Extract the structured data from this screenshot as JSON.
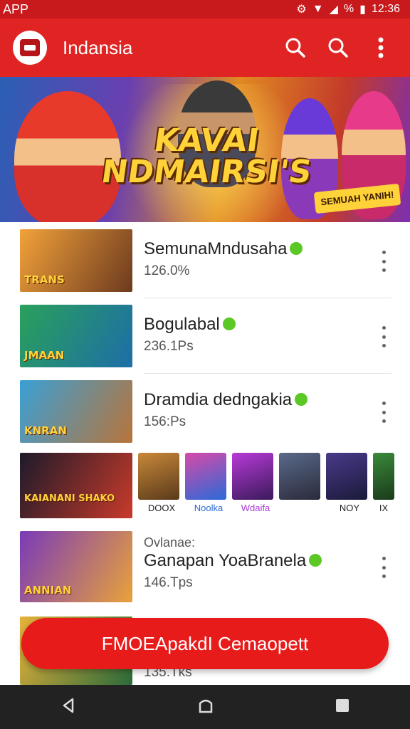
{
  "status_bar": {
    "left_label": "APP",
    "right_label": "%",
    "time": "12:36"
  },
  "app_bar": {
    "title": "Indansia"
  },
  "banner": {
    "title_line1": "KAVAI",
    "title_line2": "NDMAIRSI'S",
    "badge": "SEMUAH YANIH!"
  },
  "list": {
    "items": [
      {
        "title": "SemunaMndusaha",
        "sub": "126.0%",
        "thumb_label": "TRANS",
        "colors": [
          "#f2a23a",
          "#6d3a1f"
        ]
      },
      {
        "title": "Bogulabal",
        "sub": "236.1Ps",
        "thumb_label": "JMAAN",
        "colors": [
          "#2aa05a",
          "#1d6ea8"
        ]
      },
      {
        "title": "Dramdia dedngakia",
        "sub": "156:Ps",
        "thumb_label": "KNRAN",
        "colors": [
          "#3aa0d6",
          "#b8743a"
        ]
      },
      {
        "title": "Ganapan YoaBranela",
        "sub": "146.Tps",
        "pre": "Ovlanae:",
        "thumb_label": "ANNIAN",
        "colors": [
          "#7a3ab8",
          "#e8a23a"
        ]
      },
      {
        "sub": "135.Tks",
        "colors": [
          "#e8b23a",
          "#2a6a3a"
        ]
      }
    ],
    "featured": {
      "thumb_label": "KAIANANI SHAKO",
      "colors": [
        "#1d1a2a",
        "#c83a2a"
      ]
    },
    "strip": [
      {
        "caption": "DOOX",
        "color": "#c8883a",
        "cap_color": "#222222"
      },
      {
        "caption": "Noolka",
        "color": "#d84aa8",
        "cap_color": "#2a6ad8"
      },
      {
        "caption": "Wdaifa",
        "color": "#b83ad8",
        "cap_color": "#a83ad8"
      },
      {
        "caption": "",
        "color": "#5a6a8a",
        "cap_color": "#222222"
      },
      {
        "caption": "NOY",
        "color": "#4a3a8a",
        "cap_color": "#222222"
      },
      {
        "caption": "IX",
        "color": "#3a8a3a",
        "cap_color": "#222222"
      }
    ]
  },
  "cta": {
    "label": "FMOEApakdI Cemaopett"
  }
}
